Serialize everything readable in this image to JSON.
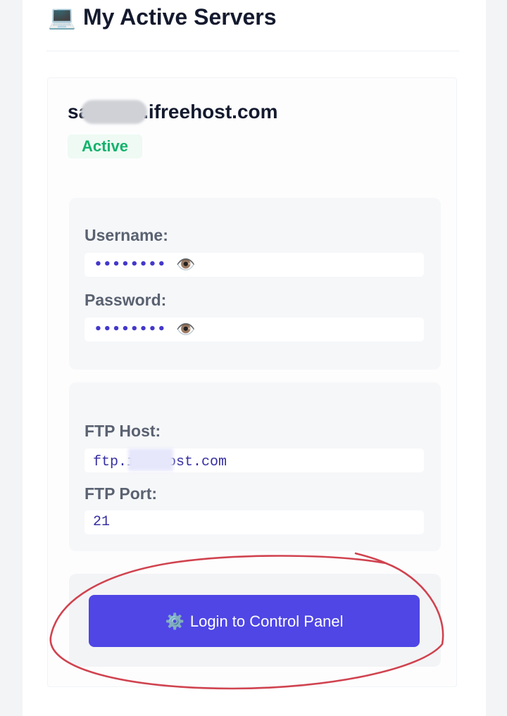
{
  "header": {
    "icon": "laptop-icon",
    "icon_glyph": "💻",
    "title": "My Active Servers"
  },
  "server": {
    "name_prefix": "sa",
    "name_suffix": ".ifreehost.com",
    "status": "Active",
    "status_color": "#13b26c",
    "credentials": {
      "username_label": "Username:",
      "username_value": "••••••••",
      "password_label": "Password:",
      "password_value": "••••••••",
      "reveal_icon": "eye-icon",
      "reveal_glyph": "👁️"
    },
    "ftp": {
      "host_label": "FTP Host:",
      "host_prefix": "ftp.i",
      "host_suffix": "ost.com",
      "port_label": "FTP Port:",
      "port_value": "21"
    },
    "login_button": {
      "icon": "gear-icon",
      "icon_glyph": "⚙️",
      "label": "Login to Control Panel",
      "color": "#4f46e5"
    }
  },
  "annotation_color": "#d0434f"
}
